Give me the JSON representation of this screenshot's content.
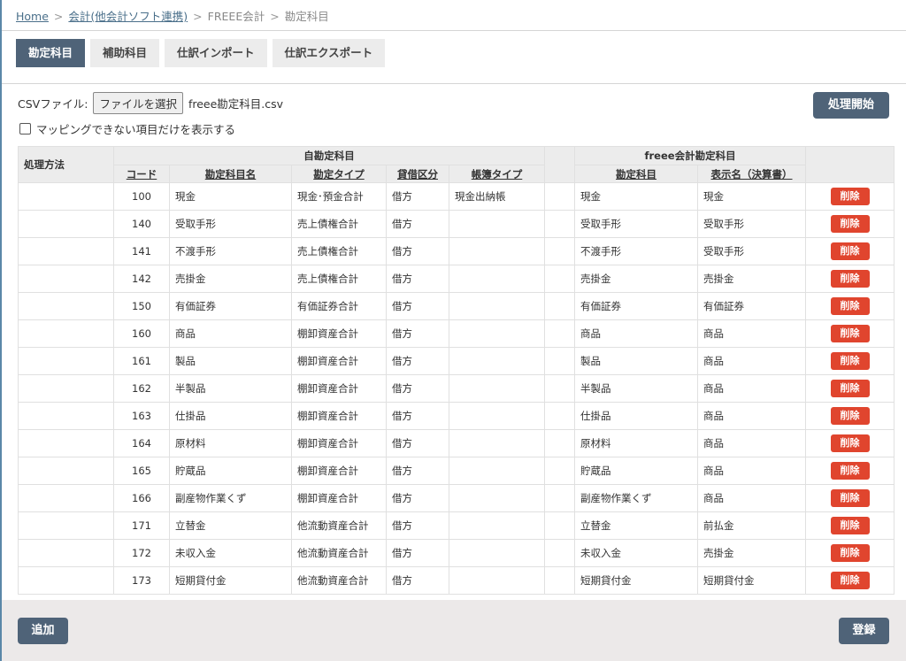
{
  "breadcrumb": {
    "home": "Home",
    "accounting": "会計(他会計ソフト連携)",
    "freee": "FREEE会計",
    "current": "勘定科目",
    "sep": ">"
  },
  "tabs": [
    {
      "label": "勘定科目"
    },
    {
      "label": "補助科目"
    },
    {
      "label": "仕訳インポート"
    },
    {
      "label": "仕訳エクスポート"
    }
  ],
  "csv": {
    "label": "CSVファイル:",
    "choose_button": "ファイルを選択",
    "filename": "freee勘定科目.csv"
  },
  "filter": {
    "label": "マッピングできない項目だけを表示する",
    "checked": false
  },
  "start_button": "処理開始",
  "table": {
    "method_header": "処理方法",
    "own_group": "自勘定科目",
    "freee_group": "freee会計勘定科目",
    "columns": {
      "code": "コード",
      "name": "勘定科目名",
      "type": "勘定タイプ",
      "side": "貸借区分",
      "book": "帳簿タイプ",
      "freee_account": "勘定科目",
      "display_name": "表示名（決算書）"
    },
    "delete_label": "削除",
    "rows": [
      {
        "code": "100",
        "name": "現金",
        "type": "現金･預金合計",
        "side": "借方",
        "book": "現金出納帳",
        "freee": "現金",
        "display": "現金"
      },
      {
        "code": "140",
        "name": "受取手形",
        "type": "売上債権合計",
        "side": "借方",
        "book": "",
        "freee": "受取手形",
        "display": "受取手形"
      },
      {
        "code": "141",
        "name": "不渡手形",
        "type": "売上債権合計",
        "side": "借方",
        "book": "",
        "freee": "不渡手形",
        "display": "受取手形"
      },
      {
        "code": "142",
        "name": "売掛金",
        "type": "売上債権合計",
        "side": "借方",
        "book": "",
        "freee": "売掛金",
        "display": "売掛金"
      },
      {
        "code": "150",
        "name": "有価証券",
        "type": "有価証券合計",
        "side": "借方",
        "book": "",
        "freee": "有価証券",
        "display": "有価証券"
      },
      {
        "code": "160",
        "name": "商品",
        "type": "棚卸資産合計",
        "side": "借方",
        "book": "",
        "freee": "商品",
        "display": "商品"
      },
      {
        "code": "161",
        "name": "製品",
        "type": "棚卸資産合計",
        "side": "借方",
        "book": "",
        "freee": "製品",
        "display": "商品"
      },
      {
        "code": "162",
        "name": "半製品",
        "type": "棚卸資産合計",
        "side": "借方",
        "book": "",
        "freee": "半製品",
        "display": "商品"
      },
      {
        "code": "163",
        "name": "仕掛品",
        "type": "棚卸資産合計",
        "side": "借方",
        "book": "",
        "freee": "仕掛品",
        "display": "商品"
      },
      {
        "code": "164",
        "name": "原材料",
        "type": "棚卸資産合計",
        "side": "借方",
        "book": "",
        "freee": "原材料",
        "display": "商品"
      },
      {
        "code": "165",
        "name": "貯蔵品",
        "type": "棚卸資産合計",
        "side": "借方",
        "book": "",
        "freee": "貯蔵品",
        "display": "商品"
      },
      {
        "code": "166",
        "name": "副産物作業くず",
        "type": "棚卸資産合計",
        "side": "借方",
        "book": "",
        "freee": "副産物作業くず",
        "display": "商品"
      },
      {
        "code": "171",
        "name": "立替金",
        "type": "他流動資産合計",
        "side": "借方",
        "book": "",
        "freee": "立替金",
        "display": "前払金"
      },
      {
        "code": "172",
        "name": "未収入金",
        "type": "他流動資産合計",
        "side": "借方",
        "book": "",
        "freee": "未収入金",
        "display": "売掛金"
      },
      {
        "code": "173",
        "name": "短期貸付金",
        "type": "他流動資産合計",
        "side": "借方",
        "book": "",
        "freee": "短期貸付金",
        "display": "短期貸付金"
      }
    ]
  },
  "add_button": "追加",
  "save_button": "登録",
  "colors": {
    "primary": "#4f6378",
    "danger": "#e0452e",
    "header_bg": "#ececec",
    "footer_bg": "#ece9e9"
  }
}
